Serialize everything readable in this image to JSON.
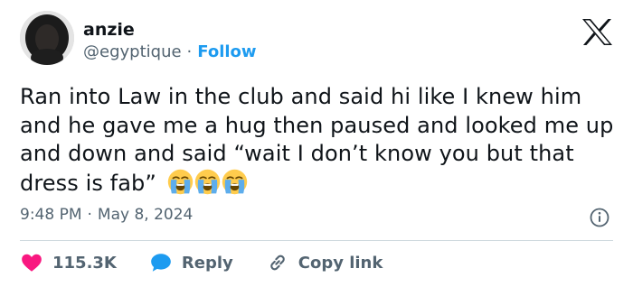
{
  "user": {
    "name": "anzie",
    "handle": "@egyptique",
    "separator": "·",
    "follow_label": "Follow"
  },
  "tweet": {
    "text": "Ran into Law in the club and said hi like I knew him and he gave me a hug then paused and looked me up and down and said “wait I don’t know you but that dress is fab”",
    "emojis": [
      "loudly-crying-face",
      "loudly-crying-face",
      "loudly-crying-face"
    ]
  },
  "meta": {
    "time": "9:48 PM",
    "separator": "·",
    "date": "May 8, 2024"
  },
  "actions": {
    "likes": "115.3K",
    "reply_label": "Reply",
    "copy_label": "Copy link"
  },
  "colors": {
    "text": "#0f1419",
    "secondary": "#536471",
    "accent": "#1d9bf0",
    "like": "#f91880",
    "divider": "#cfd9de"
  },
  "icons": {
    "brand": "x-logo-icon",
    "info": "info-icon",
    "like": "heart-icon",
    "reply": "speech-bubble-icon",
    "copy": "link-icon"
  }
}
